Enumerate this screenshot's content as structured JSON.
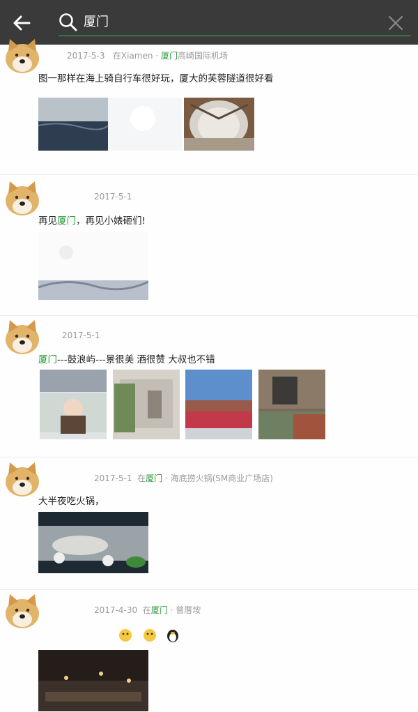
{
  "header": {
    "query": "厦门",
    "colors": {
      "bar": "#3a3a3a",
      "accent": "#2dbe3c"
    }
  },
  "posts": [
    {
      "date": "2017-5-3",
      "place_prefix": "在Xiamen ·",
      "place_highlight": "厦门",
      "place_suffix": "高崎国际机场",
      "text_before": "图一那样在海上骑自行车很好玩，厦大的芙蓉隧道很好看",
      "text_highlight": "",
      "text_after": ""
    },
    {
      "date": "2017-5-1",
      "place_prefix": "",
      "place_highlight": "",
      "place_suffix": "",
      "text_before": "再见",
      "text_highlight": "厦门",
      "text_after": "，再见小婊砸们!"
    },
    {
      "date": "2017-5-1",
      "place_prefix": "",
      "place_highlight": "",
      "place_suffix": "",
      "text_before": "",
      "text_highlight": "厦门",
      "text_after": "---鼓浪屿---景很美 酒很赞 大叔也不错"
    },
    {
      "date": "2017-5-1",
      "place_prefix": "在",
      "place_highlight": "厦门",
      "place_suffix": " · 海底捞火锅(SM商业广场店)",
      "text_before": "大半夜吃火锅，",
      "text_highlight": "",
      "text_after": ""
    },
    {
      "date": "2017-4-30",
      "place_prefix": "在",
      "place_highlight": "厦门",
      "place_suffix": " · 曾厝垵",
      "text_before": "",
      "text_highlight": "",
      "text_after": ""
    }
  ]
}
